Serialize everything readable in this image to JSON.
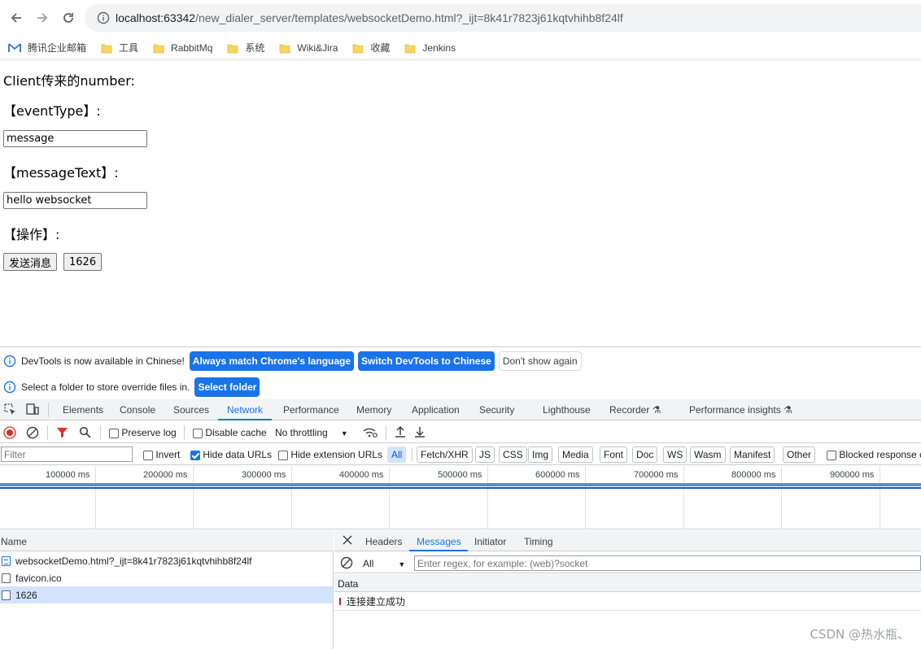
{
  "browser": {
    "url_host": "localhost:63342",
    "url_path": "/new_dialer_server/templates/websocketDemo.html?_ijt=8k41r7823j61kqtvhihb8f24lf",
    "bookmarks": [
      {
        "label": "腾讯企业邮箱",
        "icon": "tencent-mail-icon"
      },
      {
        "label": "工具",
        "icon": "folder-icon"
      },
      {
        "label": "RabbitMq",
        "icon": "folder-icon"
      },
      {
        "label": "系统",
        "icon": "folder-icon"
      },
      {
        "label": "Wiki&Jira",
        "icon": "folder-icon"
      },
      {
        "label": "收藏",
        "icon": "folder-icon"
      },
      {
        "label": "Jenkins",
        "icon": "folder-icon"
      }
    ]
  },
  "page": {
    "title": "Client传来的number:",
    "event_type_label": "【eventType】:",
    "event_type_value": "message",
    "message_text_label": "【messageText】:",
    "message_text_value": "hello websocket",
    "operation_label": "【操作】:",
    "send_button": "发送消息",
    "number_button": "1626"
  },
  "devtools": {
    "language_info": "DevTools is now available in Chinese!",
    "always_match": "Always match Chrome's language",
    "switch_chinese": "Switch DevTools to Chinese",
    "dont_show": "Don't show again",
    "folder_info": "Select a folder to store override files in.",
    "select_folder": "Select folder",
    "tabs": [
      "Elements",
      "Console",
      "Sources",
      "Network",
      "Performance",
      "Memory",
      "Application",
      "Security",
      "Lighthouse",
      "Recorder",
      "Performance insights"
    ],
    "active_tab": "Network",
    "toolbar": {
      "preserve_log": "Preserve log",
      "disable_cache": "Disable cache",
      "throttling": "No throttling"
    },
    "filter": {
      "placeholder": "Filter",
      "invert": "Invert",
      "hide_data_urls": "Hide data URLs",
      "hide_extension_urls": "Hide extension URLs",
      "types": [
        "All",
        "Fetch/XHR",
        "JS",
        "CSS",
        "Img",
        "Media",
        "Font",
        "Doc",
        "WS",
        "Wasm",
        "Manifest",
        "Other"
      ],
      "blocked": "Blocked response c"
    },
    "timeline_ticks": [
      "100000 ms",
      "200000 ms",
      "300000 ms",
      "400000 ms",
      "500000 ms",
      "600000 ms",
      "700000 ms",
      "800000 ms",
      "900000 ms"
    ],
    "name_header": "Name",
    "requests": [
      {
        "name": "websocketDemo.html?_ijt=8k41r7823j61kqtvhihb8f24lf",
        "icon": "document-icon"
      },
      {
        "name": "favicon.ico",
        "icon": "file-icon"
      },
      {
        "name": "1626",
        "icon": "file-icon"
      }
    ],
    "detail_tabs": [
      "Headers",
      "Messages",
      "Initiator",
      "Timing"
    ],
    "active_detail_tab": "Messages",
    "messages": {
      "filter_all": "All",
      "regex_placeholder": "Enter regex, for example: (web)?socket",
      "data_header": "Data",
      "rows": [
        "连接建立成功"
      ]
    }
  },
  "watermark": "CSDN @热水瓶、"
}
